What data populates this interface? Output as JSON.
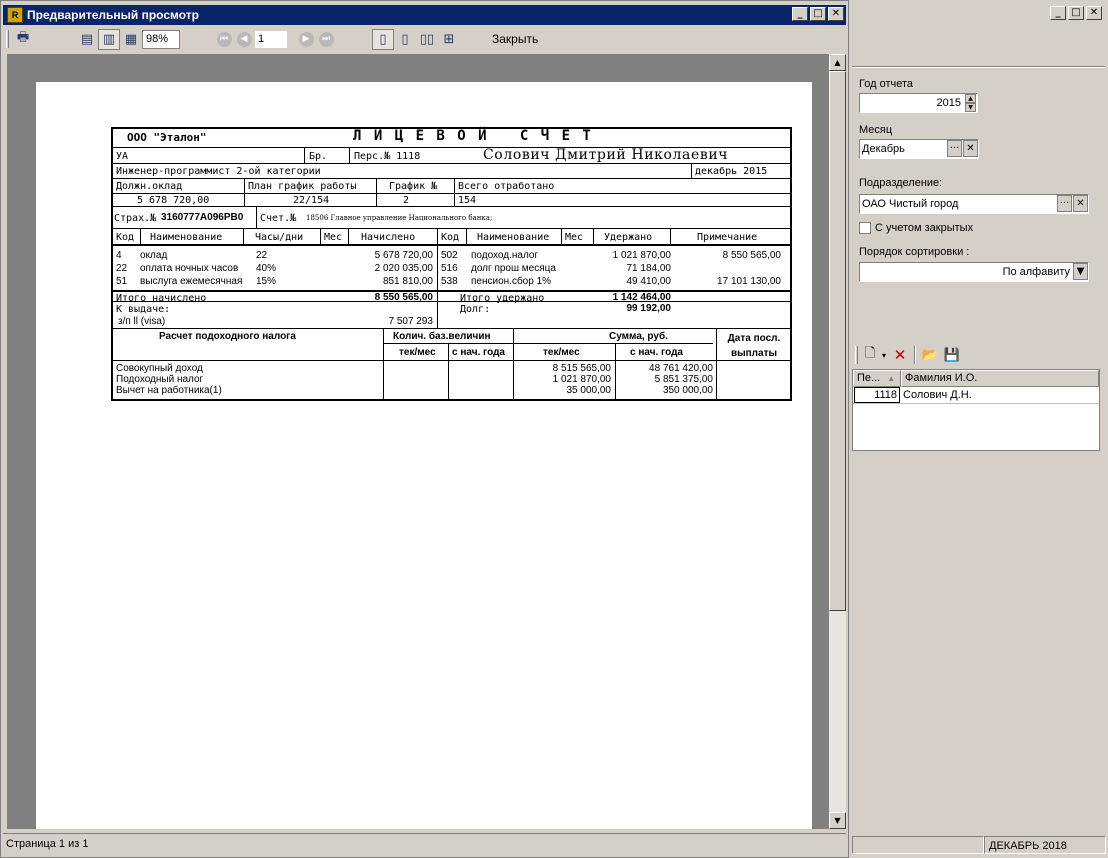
{
  "window": {
    "title": "Предварительный просмотр",
    "app_icon": "R"
  },
  "toolbar": {
    "zoom": "98%",
    "page_number": "1",
    "close_label": "Закрыть"
  },
  "status": {
    "page_info": "Страница 1 из 1"
  },
  "report": {
    "org": "ООО \"Эталон\"",
    "title": "Л И Ц Е В О Й   С Ч Е Т",
    "dept": "УА",
    "br_label": "Бр.",
    "pers_label": "Перс.№ 1118",
    "fio": "Солович Дмитрий Николаевич",
    "position": "Инженер-программист 2-ой категории",
    "period": "декабрь 2015",
    "h_salary": "Должн.оклад",
    "h_plan": "План график работы",
    "h_graph": "График №",
    "h_worked": "Всего отработано",
    "v_salary": "5 678 720,00",
    "v_plan": "22/154",
    "v_graph": "2",
    "v_worked": "154",
    "ins_label": "Страх.№",
    "ins_number": "3160777A096PB0",
    "acc_label": "Счет.№",
    "acc_text": "18506 Главное управление Национального банка;",
    "col_code": "Код",
    "col_name": "Наименование",
    "col_hours": "Часы/дни",
    "col_month": "Мес",
    "col_accrued": "Начислено",
    "col_code2": "Код",
    "col_name2": "Наименование",
    "col_month2": "Мес",
    "col_withheld": "Удержано",
    "col_note": "Примечание",
    "accruals": [
      {
        "code": "4",
        "name": "оклад",
        "hours": "22",
        "amount": "5 678 720,00"
      },
      {
        "code": "22",
        "name": "оплата ночных часов",
        "hours": "40%",
        "amount": "2 020 035,00"
      },
      {
        "code": "51",
        "name": "выслуга ежемесячная",
        "hours": "15%",
        "amount": "851 810,00"
      }
    ],
    "deductions": [
      {
        "code": "502",
        "name": "подоход.налог",
        "amount": "1 021 870,00",
        "note": "8 550 565,00"
      },
      {
        "code": "516",
        "name": "долг прош месяца",
        "amount": "71 184,00",
        "note": ""
      },
      {
        "code": "538",
        "name": "пенсион.сбор 1%",
        "amount": "49 410,00",
        "note": "17 101 130,00"
      }
    ],
    "total_accrued_label": "Итого начислено",
    "total_accrued": "8 550 565,00",
    "total_withheld_label": "Итого удержано",
    "total_withheld": "1 142 464,00",
    "payout_label": "К выдаче:",
    "debt_label": "Долг:",
    "debt": "99 192,00",
    "payout_method": "з/п ll (visa)",
    "payout": "7 507 293",
    "tax_title": "Расчет подоходного налога",
    "base_qty": "Колич. баз.величин",
    "sum_rub": "Сумма, руб.",
    "last_pay": "Дата посл. выплаты",
    "cur_month": "тек/мес",
    "from_start": "с нач. года",
    "cur_month2": "тек/мес",
    "from_start2": "с нач. года",
    "tax_rows": [
      {
        "name": "Совокупный доход",
        "cur": "8 515 565,00",
        "ytd": "48 761 420,00"
      },
      {
        "name": "Подоходный налог",
        "cur": "1 021 870,00",
        "ytd": "5 851 375,00"
      },
      {
        "name": "Вычет на работника(1)",
        "cur": "35 000,00",
        "ytd": "350 000,00"
      }
    ]
  },
  "panel": {
    "year_label": "Год отчета",
    "year_value": "2015",
    "month_label": "Месяц",
    "month_value": "Декабрь",
    "dept_label": "Подразделение:",
    "dept_value": "ОАО Чистый город",
    "closed_label": "С учетом закрытых",
    "sort_label": "Порядок сортировки :",
    "sort_value": "По алфавиту",
    "grid_col1": "Пе...",
    "grid_col2": "Фамилия И.О.",
    "grid_rows": [
      {
        "num": "1118",
        "name": "Солович Д.Н."
      }
    ],
    "status_period": "ДЕКАБРЬ 2018"
  }
}
